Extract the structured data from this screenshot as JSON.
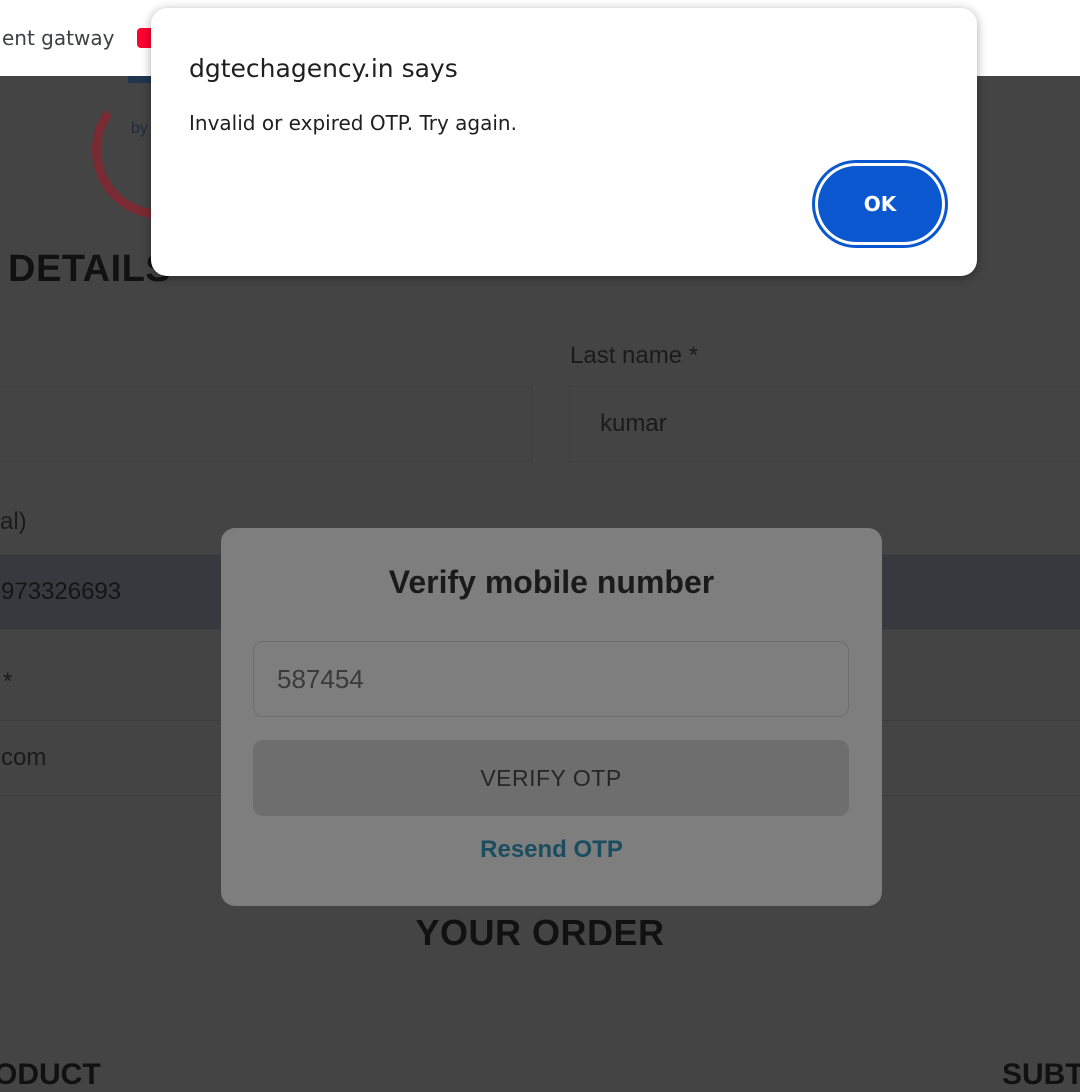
{
  "browser": {
    "bookmark_label": "ent gatway"
  },
  "page": {
    "logo_text": "by",
    "section_title": "DETAILS",
    "last_name_label": "Last name *",
    "last_name_value": "kumar",
    "phone_label": "al)",
    "phone_value": "973326693",
    "email_label": "*",
    "email_value": "com",
    "order_title": "YOUR ORDER",
    "product_header": "ODUCT",
    "subtotal_header": "SUBT"
  },
  "otp_modal": {
    "title": "Verify mobile number",
    "otp_value": "587454",
    "verify_button": "VERIFY OTP",
    "resend_link": "Resend OTP"
  },
  "alert": {
    "title": "dgtechagency.in says",
    "message": "Invalid or expired OTP. Try again.",
    "ok_button": "OK"
  },
  "colors": {
    "dialog_button": "#0b57d0",
    "resend_link": "#1a4d60",
    "page_overlay": "#444444"
  }
}
